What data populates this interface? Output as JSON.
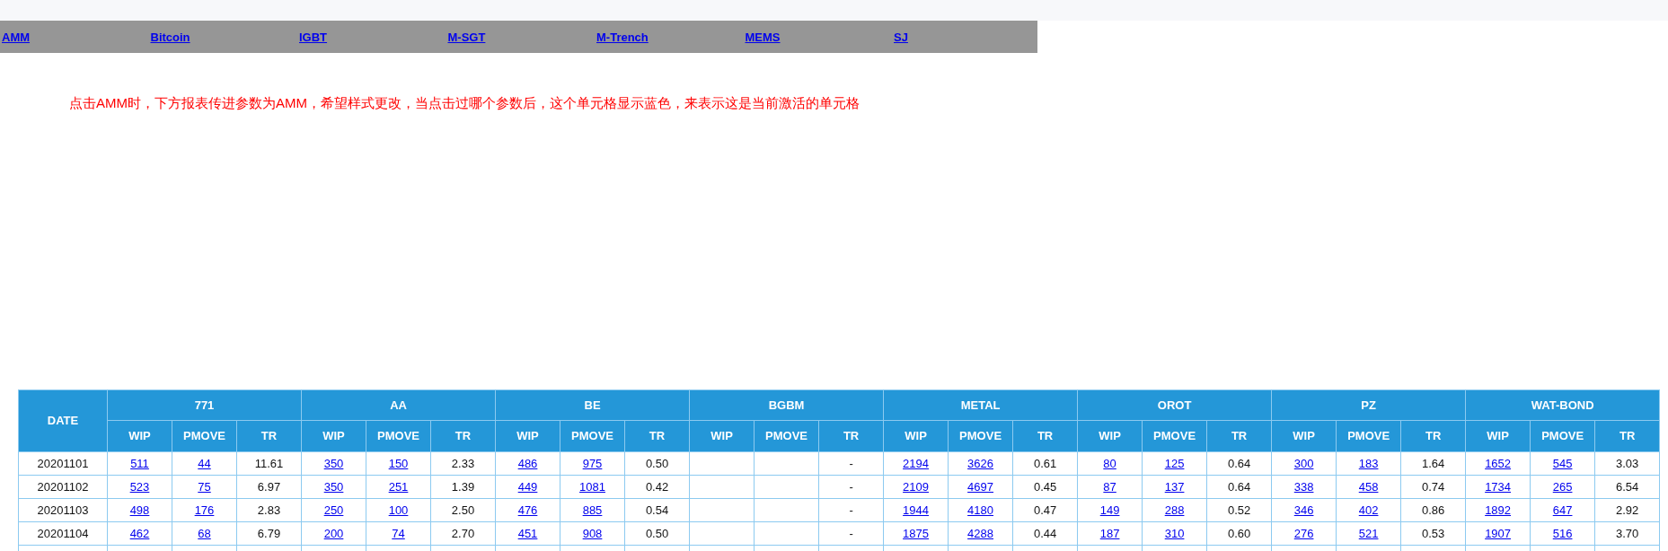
{
  "nav": {
    "links": [
      "AMM",
      "Bitcoin",
      "IGBT",
      "M-SGT",
      "M-Trench",
      "MEMS",
      "SJ"
    ]
  },
  "note": "点击AMM时，下方报表传进参数为AMM，希望样式更改，当点击过哪个参数后，这个单元格显示蓝色，来表示这是当前激活的单元格",
  "table": {
    "date_header": "DATE",
    "groups": [
      {
        "name": "771",
        "columns": [
          "WIP",
          "PMOVE",
          "TR"
        ]
      },
      {
        "name": "AA",
        "columns": [
          "WIP",
          "PMOVE",
          "TR"
        ]
      },
      {
        "name": "BE",
        "columns": [
          "WIP",
          "PMOVE",
          "TR"
        ]
      },
      {
        "name": "BGBM",
        "columns": [
          "WIP",
          "PMOVE",
          "TR"
        ]
      },
      {
        "name": "METAL",
        "columns": [
          "WIP",
          "PMOVE",
          "TR"
        ]
      },
      {
        "name": "OROT",
        "columns": [
          "WIP",
          "PMOVE",
          "TR"
        ]
      },
      {
        "name": "PZ",
        "columns": [
          "WIP",
          "PMOVE",
          "TR"
        ]
      },
      {
        "name": "WAT-BOND",
        "columns": [
          "WIP",
          "PMOVE",
          "TR"
        ]
      }
    ],
    "rows": [
      {
        "date": "20201101",
        "cells": [
          [
            "511",
            "44",
            "11.61"
          ],
          [
            "350",
            "150",
            "2.33"
          ],
          [
            "486",
            "975",
            "0.50"
          ],
          [
            null,
            null,
            "-"
          ],
          [
            "2194",
            "3626",
            "0.61"
          ],
          [
            "80",
            "125",
            "0.64"
          ],
          [
            "300",
            "183",
            "1.64"
          ],
          [
            "1652",
            "545",
            "3.03"
          ]
        ]
      },
      {
        "date": "20201102",
        "cells": [
          [
            "523",
            "75",
            "6.97"
          ],
          [
            "350",
            "251",
            "1.39"
          ],
          [
            "449",
            "1081",
            "0.42"
          ],
          [
            null,
            null,
            "-"
          ],
          [
            "2109",
            "4697",
            "0.45"
          ],
          [
            "87",
            "137",
            "0.64"
          ],
          [
            "338",
            "458",
            "0.74"
          ],
          [
            "1734",
            "265",
            "6.54"
          ]
        ]
      },
      {
        "date": "20201103",
        "cells": [
          [
            "498",
            "176",
            "2.83"
          ],
          [
            "250",
            "100",
            "2.50"
          ],
          [
            "476",
            "885",
            "0.54"
          ],
          [
            null,
            null,
            "-"
          ],
          [
            "1944",
            "4180",
            "0.47"
          ],
          [
            "149",
            "288",
            "0.52"
          ],
          [
            "346",
            "402",
            "0.86"
          ],
          [
            "1892",
            "647",
            "2.92"
          ]
        ]
      },
      {
        "date": "20201104",
        "cells": [
          [
            "462",
            "68",
            "6.79"
          ],
          [
            "200",
            "74",
            "2.70"
          ],
          [
            "451",
            "908",
            "0.50"
          ],
          [
            null,
            null,
            "-"
          ],
          [
            "1875",
            "4288",
            "0.44"
          ],
          [
            "187",
            "310",
            "0.60"
          ],
          [
            "276",
            "521",
            "0.53"
          ],
          [
            "1907",
            "516",
            "3.70"
          ]
        ]
      }
    ]
  }
}
